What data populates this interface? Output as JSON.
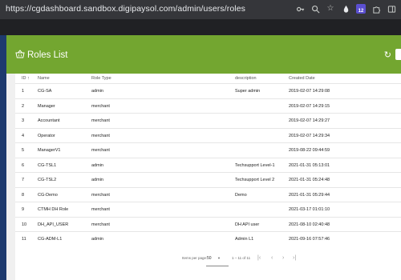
{
  "browser": {
    "url": "https://cgdashboard.sandbox.digipaysol.com/admin/users/roles",
    "extension_badge": "12",
    "icons": [
      "key-icon",
      "zoom-icon",
      "star-icon",
      "drop-icon",
      "extension-badge-icon",
      "puzzle-icon",
      "sidepanel-icon"
    ]
  },
  "header": {
    "title": "Roles List",
    "icon": "basket-icon",
    "refresh_icon": "refresh-icon",
    "accent": "#73a630"
  },
  "table": {
    "columns": {
      "id": "ID",
      "name": "Name",
      "role_type": "Role Type",
      "description": "description",
      "created_date": "Created Date"
    },
    "sort_indicator": "↑",
    "rows": [
      {
        "id": "1",
        "name": "CG-SA",
        "role_type": "admin",
        "description": "Super admin",
        "created_date": "2019-02-07 14:29:08"
      },
      {
        "id": "2",
        "name": "Manager",
        "role_type": "merchant",
        "description": "",
        "created_date": "2019-02-07 14:29:15"
      },
      {
        "id": "3",
        "name": "Accountant",
        "role_type": "merchant",
        "description": "",
        "created_date": "2019-02-07 14:29:27"
      },
      {
        "id": "4",
        "name": "Operator",
        "role_type": "merchant",
        "description": "",
        "created_date": "2019-02-07 14:29:34"
      },
      {
        "id": "5",
        "name": "ManagerV1",
        "role_type": "merchant",
        "description": "",
        "created_date": "2019-08-22 09:44:59"
      },
      {
        "id": "6",
        "name": "CG-TSL1",
        "role_type": "admin",
        "description": "Techsupport Level-1",
        "created_date": "2021-01-31 05:13:01"
      },
      {
        "id": "7",
        "name": "CG-TSL2",
        "role_type": "admin",
        "description": "Techsupport Level 2",
        "created_date": "2021-01-31 05:24:48"
      },
      {
        "id": "8",
        "name": "CG-Demo",
        "role_type": "merchant",
        "description": "Demo",
        "created_date": "2021-01-31 05:29:44"
      },
      {
        "id": "9",
        "name": "CTMH DH Role",
        "role_type": "merchant",
        "description": "",
        "created_date": "2021-03-17 01:01:10"
      },
      {
        "id": "10",
        "name": "DH_API_USER",
        "role_type": "merchant",
        "description": "DH API user",
        "created_date": "2021-08-10 02:40:48"
      },
      {
        "id": "11",
        "name": "CG-ADM-L1",
        "role_type": "admin",
        "description": "Admin L1",
        "created_date": "2021-09-16 07:57:46"
      }
    ]
  },
  "paginator": {
    "items_per_page_label": "Items per page:",
    "page_size": "50",
    "range_label": "1 – 11 of 11"
  }
}
